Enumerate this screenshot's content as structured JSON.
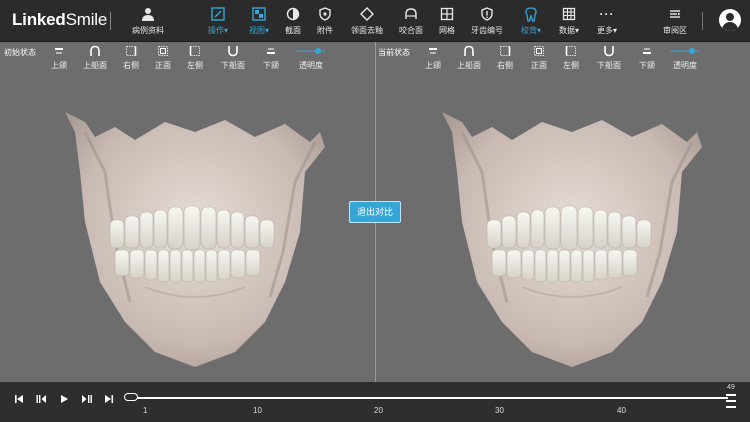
{
  "app": {
    "logo_bold": "Linked",
    "logo_light": "Smile"
  },
  "toolbar": {
    "items": [
      {
        "label": "病例资料",
        "icon": "person-icon",
        "active": false
      },
      {
        "label": "操作▾",
        "icon": "operation-icon",
        "active": true
      },
      {
        "label": "视图▾",
        "icon": "view-grid-icon",
        "active": true
      },
      {
        "label": "截面",
        "icon": "half-circle-icon",
        "active": false
      },
      {
        "label": "附件",
        "icon": "shield-icon",
        "active": false
      },
      {
        "label": "领面去釉",
        "icon": "diamond-icon",
        "active": false
      },
      {
        "label": "咬合面",
        "icon": "bite-icon",
        "active": false
      },
      {
        "label": "网格",
        "icon": "grid-icon",
        "active": false
      },
      {
        "label": "牙齿编号",
        "icon": "tooth-number-icon",
        "active": false
      },
      {
        "label": "校背▾",
        "icon": "tooth-icon",
        "active": true
      },
      {
        "label": "数据▾",
        "icon": "table-icon",
        "active": false
      },
      {
        "label": "更多▾",
        "icon": "more-icon",
        "active": false
      },
      {
        "label": "审阅区",
        "icon": "review-icon",
        "active": false
      }
    ]
  },
  "left_panel": {
    "state_label": "初始状态",
    "views": [
      "上颌",
      "上船面",
      "右侧",
      "正面",
      "左侧",
      "下船面",
      "下颌",
      "透明度"
    ]
  },
  "right_panel": {
    "state_label": "当前状态",
    "views": [
      "上颌",
      "上船面",
      "右侧",
      "正面",
      "左侧",
      "下船面",
      "下颌",
      "透明度"
    ]
  },
  "compare_button": "退出对比",
  "timeline": {
    "ticks": [
      "1",
      "10",
      "20",
      "30",
      "40"
    ],
    "max_step": "49",
    "current_step": 1
  },
  "colors": {
    "accent": "#34a8d8",
    "toolbar_bg": "#2b2b2b",
    "viewport_bg": "#6d6d6d"
  }
}
